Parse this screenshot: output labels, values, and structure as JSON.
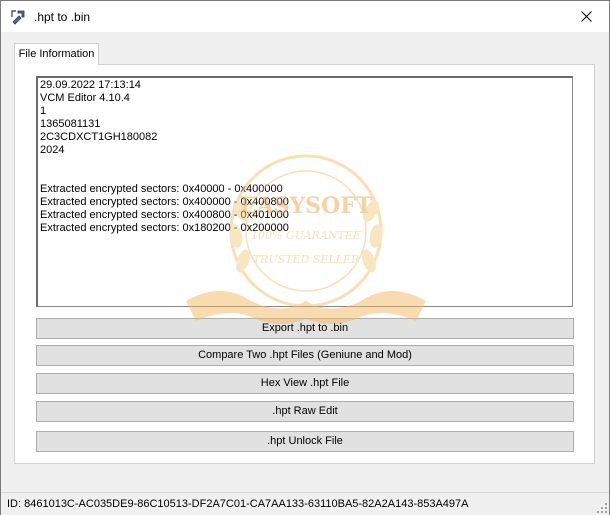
{
  "window": {
    "title": ".hpt to .bin"
  },
  "tabs": [
    {
      "label": "File Information"
    }
  ],
  "info_text": "29.09.2022 17:13:14\nVCM Editor 4.10.4\n1\n1365081131\n2C3CDXCT1GH180082\n2024\n\n\nExtracted encrypted sectors: 0x40000 - 0x400000\nExtracted encrypted sectors: 0x400000 - 0x400800\nExtracted encrypted sectors: 0x400800 - 0x401000\nExtracted encrypted sectors: 0x180200 - 0x200000",
  "buttons": {
    "export": "Export .hpt to .bin",
    "compare": "Compare Two .hpt Files (Geniune and Mod)",
    "hex_view": "Hex View .hpt File",
    "raw_edit": ".hpt Raw Edit",
    "unlock": ".hpt Unlock File"
  },
  "watermark": {
    "brand": "EASYSOFT",
    "line1": "100% GUARANTEE",
    "line2": "TRUSTED SELLER"
  },
  "status": {
    "id_text": "ID:  8461013C-AC035DE9-86C10513-DF2A7C01-CA7AA133-63110BA5-82A2A143-853A497A"
  }
}
